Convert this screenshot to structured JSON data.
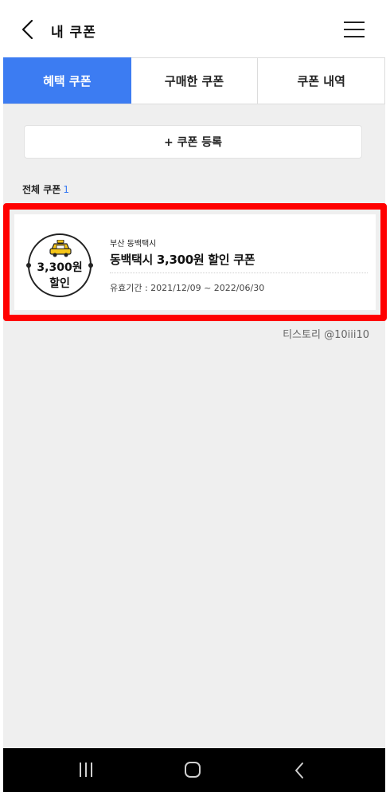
{
  "header": {
    "title": "내 쿠폰",
    "back_icon": "chevron-left-icon",
    "menu_icon": "hamburger-menu-icon"
  },
  "tabs": [
    {
      "label": "혜택 쿠폰",
      "active": true
    },
    {
      "label": "구매한 쿠폰",
      "active": false
    },
    {
      "label": "쿠폰 내역",
      "active": false
    }
  ],
  "register": {
    "label": "+ 쿠폰 등록"
  },
  "summary": {
    "label": "전체 쿠폰",
    "count": "1"
  },
  "coupon": {
    "badge_icon": "taxi-icon",
    "badge_amount": "3,300원",
    "badge_label": "할인",
    "brand": "부산 동백택시",
    "name": "동백택시 3,300원  할인 쿠폰",
    "period": "유효기간 : 2021/12/09 ~ 2022/06/30"
  },
  "watermark": "티스토리 @10iii10",
  "colors": {
    "accent": "#3c7cf2",
    "highlight": "#ff0000",
    "background": "#efefef"
  },
  "navbar": {
    "recent_icon": "recent-apps-icon",
    "home_icon": "home-icon",
    "back_icon": "back-icon"
  }
}
